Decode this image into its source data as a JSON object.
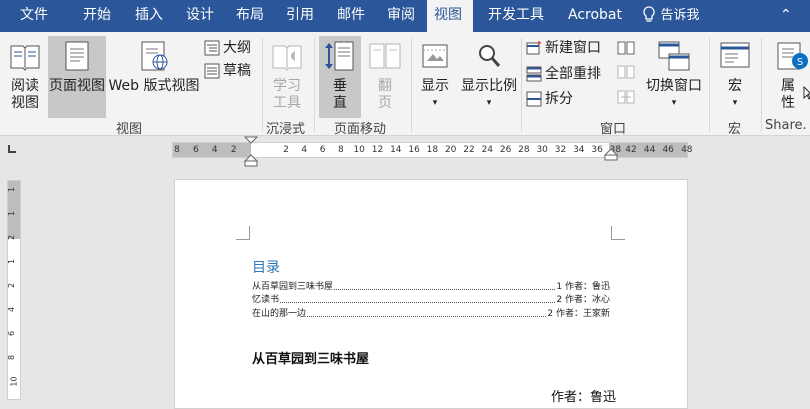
{
  "tabs": [
    "文件",
    "开始",
    "插入",
    "设计",
    "布局",
    "引用",
    "邮件",
    "审阅",
    "视图",
    "开发工具",
    "Acrobat"
  ],
  "active_tab": "视图",
  "tell_me": "告诉我",
  "groups": {
    "view": {
      "label": "视图",
      "read_mode": [
        "阅读",
        "视图"
      ],
      "print_layout": "页面视图",
      "web_layout": "Web 版式视图",
      "outline": "大纲",
      "draft": "草稿"
    },
    "immersive": {
      "label": "沉浸式",
      "learning_tools": [
        "学习",
        "工具"
      ]
    },
    "page_movement": {
      "label": "页面移动",
      "vertical": [
        "垂",
        "直"
      ],
      "side_to_side": [
        "翻",
        "页"
      ]
    },
    "show": {
      "show": "显示",
      "zoom": "显示比例"
    },
    "window": {
      "label": "窗口",
      "new_window": "新建窗口",
      "arrange_all": "全部重排",
      "split": "拆分",
      "switch_windows": "切换窗口"
    },
    "macros": {
      "label": "宏",
      "macros": "宏"
    },
    "share": {
      "label": "Share.",
      "properties": [
        "属",
        "性"
      ]
    }
  },
  "hruler": {
    "left_numbers": [
      "8",
      "6",
      "4",
      "2"
    ],
    "right_numbers": [
      "2",
      "4",
      "6",
      "8",
      "10",
      "12",
      "14",
      "16",
      "18",
      "20",
      "22",
      "24",
      "26",
      "28",
      "30",
      "32",
      "34",
      "36",
      "38"
    ],
    "right_gray_numbers": [
      "42",
      "44",
      "46",
      "48"
    ]
  },
  "vruler": {
    "numbers": [
      "1",
      "1",
      "2",
      "1",
      "2",
      "4",
      "6",
      "8",
      "10"
    ]
  },
  "document": {
    "toc_title": "目录",
    "toc": [
      {
        "title": "从百草园到三味书屋",
        "page": "1 作者：鲁迅"
      },
      {
        "title": "忆读书",
        "page": "2 作者：冰心"
      },
      {
        "title": "在山的那一边",
        "page": "2 作者：王家新"
      }
    ],
    "heading": "从百草园到三味书屋",
    "author": "作者：鲁迅"
  },
  "colors": {
    "tab_bar": "#2b579a",
    "ribbon": "#f3f3f3",
    "toc_title": "#2e74b5",
    "selected_button": "#c8c8c8"
  }
}
